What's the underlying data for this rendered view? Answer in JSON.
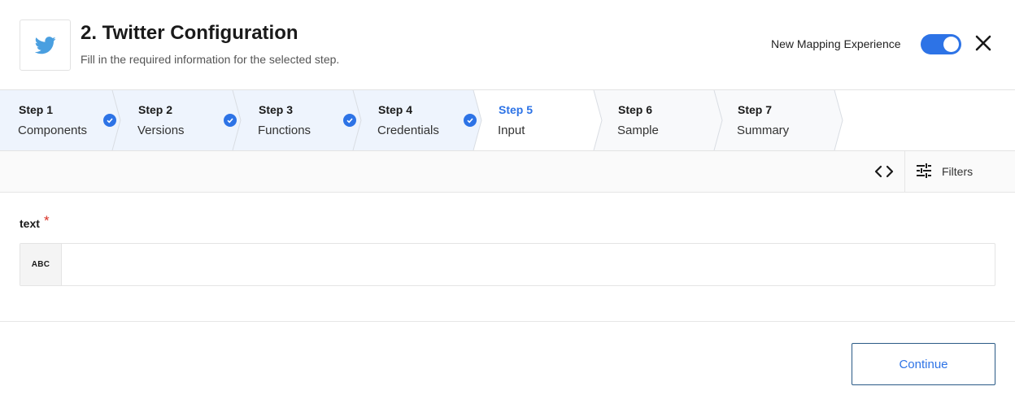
{
  "header": {
    "title": "2. Twitter Configuration",
    "subtitle": "Fill in the required information for the selected step.",
    "logo_icon": "twitter-bird-icon",
    "toggle_label": "New Mapping Experience",
    "toggle_on": true,
    "close_icon": "close-icon"
  },
  "colors": {
    "accent": "#2d73e6",
    "twitter": "#4a9fe0",
    "completed_step_bg": "#eef4fd",
    "required": "#d93025"
  },
  "steps": [
    {
      "title": "Step 1",
      "label": "Components",
      "status": "completed"
    },
    {
      "title": "Step 2",
      "label": "Versions",
      "status": "completed"
    },
    {
      "title": "Step 3",
      "label": "Functions",
      "status": "completed"
    },
    {
      "title": "Step 4",
      "label": "Credentials",
      "status": "completed"
    },
    {
      "title": "Step 5",
      "label": "Input",
      "status": "active"
    },
    {
      "title": "Step 6",
      "label": "Sample",
      "status": "pending"
    },
    {
      "title": "Step 7",
      "label": "Summary",
      "status": "pending"
    }
  ],
  "toolbar": {
    "code_icon": "code-brackets-icon",
    "filters_icon": "sliders-icon",
    "filters_label": "Filters"
  },
  "form": {
    "field_label": "text",
    "required_mark": "*",
    "type_badge": "ABC",
    "value": "",
    "placeholder": ""
  },
  "footer": {
    "continue_label": "Continue"
  }
}
